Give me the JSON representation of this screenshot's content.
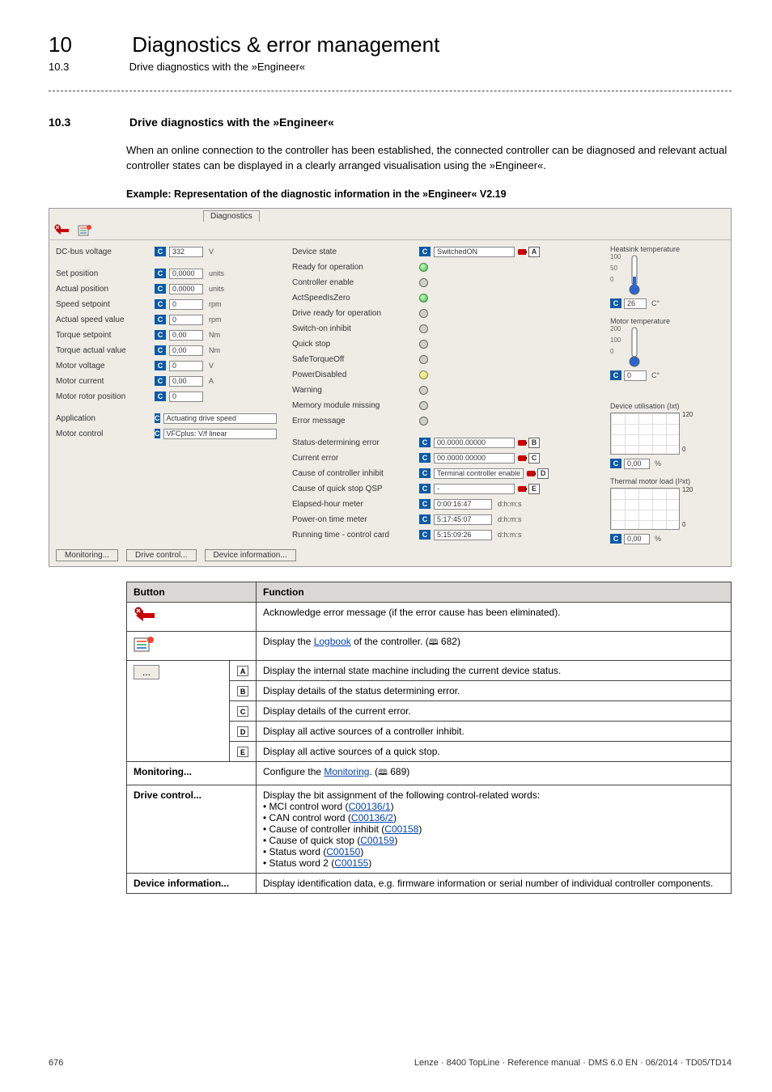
{
  "header": {
    "chapter_num": "10",
    "chapter_title": "Diagnostics & error management",
    "sub_num": "10.3",
    "sub_title": "Drive diagnostics with the »Engineer«"
  },
  "section": {
    "num": "10.3",
    "title": "Drive diagnostics with the »Engineer«"
  },
  "body_text": "When an online connection to the controller has been established, the connected controller can be diagnosed and relevant actual controller states can be displayed in a clearly arranged visualisation using the »Engineer«.",
  "caption": "Example: Representation of the diagnostic information in the »Engineer« V2.19",
  "screenshot": {
    "tab": "Diagnostics",
    "left_labels": [
      "DC-bus voltage",
      "Set position",
      "Actual position",
      "Speed setpoint",
      "Actual speed value",
      "Torque setpoint",
      "Torque actual value",
      "Motor voltage",
      "Motor current",
      "Motor rotor position",
      "Application",
      "Motor control"
    ],
    "left_values": [
      {
        "v": "332",
        "u": "V"
      },
      {
        "v": "0,0000",
        "u": "units"
      },
      {
        "v": "0,0000",
        "u": "units"
      },
      {
        "v": "0",
        "u": "rpm"
      },
      {
        "v": "0",
        "u": "rpm"
      },
      {
        "v": "0,00",
        "u": "Nm"
      },
      {
        "v": "0,00",
        "u": "Nm"
      },
      {
        "v": "0",
        "u": "V"
      },
      {
        "v": "0,00",
        "u": "A"
      },
      {
        "v": "0",
        "u": ""
      }
    ],
    "app_value": "Actuating drive speed",
    "motor_ctrl_value": "VFCplus: V/f linear",
    "mid_labels": [
      "Device state",
      "Ready for operation",
      "Controller enable",
      "ActSpeedIsZero",
      "Drive ready for operation",
      "Switch-on inhibit",
      "Quick stop",
      "SafeTorqueOff",
      "PowerDisabled",
      "Warning",
      "Memory module missing",
      "Error message",
      "Status-determining error",
      "Current error",
      "Cause of controller inhibit",
      "Cause of quick stop QSP",
      "Elapsed-hour meter",
      "Power-on time meter",
      "Running time - control card"
    ],
    "device_state_value": "SwitchedON",
    "leds": [
      "green",
      "",
      "green",
      "",
      "",
      "",
      "",
      "yellow",
      "",
      "",
      ""
    ],
    "status_err": "00.0000.00000",
    "current_err": "00.0000.00000",
    "ctrl_inhibit": "Terminal controller enable",
    "qsp_cause": "-",
    "elapsed": "0:00:16:47",
    "poweron": "5:17:45:07",
    "runtime": "5:15:09:26",
    "time_unit": "d:h:m:s",
    "badges": {
      "A": "A",
      "B": "B",
      "C": "C",
      "D": "D",
      "E": "E"
    },
    "gauges": {
      "heatsink": {
        "label": "Heatsink temperature",
        "ticks": [
          "100",
          "50",
          "0"
        ],
        "value": "26",
        "unit": "C°"
      },
      "util": {
        "label": "Device utilisation (Ixt)",
        "scale_hi": "120",
        "scale_lo": "0",
        "value": "0,00",
        "unit": "%"
      },
      "motor_temp": {
        "label": "Motor temperature",
        "ticks": [
          "200",
          "100",
          "0"
        ],
        "value": "0",
        "unit": "C°"
      },
      "thermal": {
        "label": "Thermal motor load (I²xt)",
        "scale_hi": "120",
        "scale_lo": "0",
        "value": "0,00",
        "unit": "%"
      }
    },
    "bottom_buttons": [
      "Monitoring...",
      "Drive control...",
      "Device information..."
    ]
  },
  "table": {
    "headers": [
      "Button",
      "Function"
    ],
    "rows": {
      "ack": "Acknowledge error message (if the error cause has been eliminated).",
      "logbook_pre": "Display the ",
      "logbook_link": "Logbook",
      "logbook_post": " of the controller. (",
      "logbook_page": " 682)",
      "A": "Display the internal state machine including the current device status.",
      "B": "Display details of the status determining error.",
      "C": "Display details of the current error.",
      "D": "Display all active sources of a controller inhibit.",
      "E": "Display all active sources of a quick stop.",
      "monitoring_label": "Monitoring...",
      "monitoring_pre": "Configure the ",
      "monitoring_link": "Monitoring",
      "monitoring_post": ". (",
      "monitoring_page": " 689)",
      "drive_label": "Drive control...",
      "drive_line1": "Display the bit assignment of the following control-related words:",
      "drive_b1_pre": " • MCI control word (",
      "drive_b1_link": "C00136/1",
      "drive_b1_post": ")",
      "drive_b2_pre": " • CAN control word (",
      "drive_b2_link": "C00136/2",
      "drive_b2_post": ")",
      "drive_b3_pre": " • Cause of controller inhibit (",
      "drive_b3_link": "C00158",
      "drive_b3_post": ")",
      "drive_b4_pre": " • Cause of quick stop (",
      "drive_b4_link": "C00159",
      "drive_b4_post": ")",
      "drive_b5_pre": " • Status word (",
      "drive_b5_link": "C00150",
      "drive_b5_post": ")",
      "drive_b6_pre": " • Status word 2 (",
      "drive_b6_link": "C00155",
      "drive_b6_post": ")",
      "devinfo_label": "Device information...",
      "devinfo": "Display identification data, e.g. firmware information or serial number of individual controller components."
    }
  },
  "footer": {
    "page": "676",
    "ref": "Lenze · 8400 TopLine · Reference manual · DMS 6.0 EN · 06/2014 · TD05/TD14"
  }
}
